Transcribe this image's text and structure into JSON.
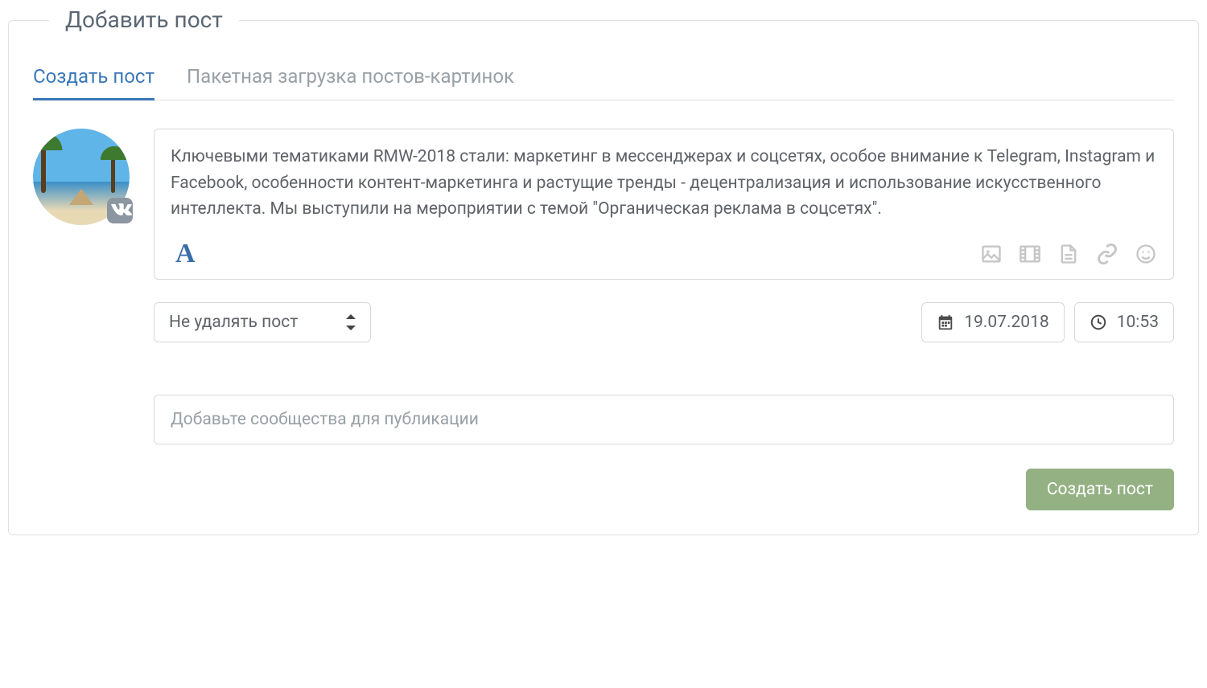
{
  "panel": {
    "title": "Добавить пост"
  },
  "tabs": {
    "create": "Создать пост",
    "batch": "Пакетная загрузка постов-картинок"
  },
  "editor": {
    "text": "Ключевыми тематиками RMW-2018 стали: маркетинг в мессенджерах и соцсетях, особое внимание к Telegram, Instagram и Facebook, особенности контент-маркетинга и растущие тренды - децентрализация и использование искусственного интеллекта. Мы выступили на мероприятии с темой \"Органическая реклама в соцсетях\"."
  },
  "controls": {
    "delete_option": "Не удалять пост",
    "date": "19.07.2018",
    "time": "10:53"
  },
  "communities": {
    "placeholder": "Добавьте сообщества для публикации"
  },
  "buttons": {
    "create": "Создать пост"
  },
  "avatar": {
    "vk_label": "VK"
  }
}
